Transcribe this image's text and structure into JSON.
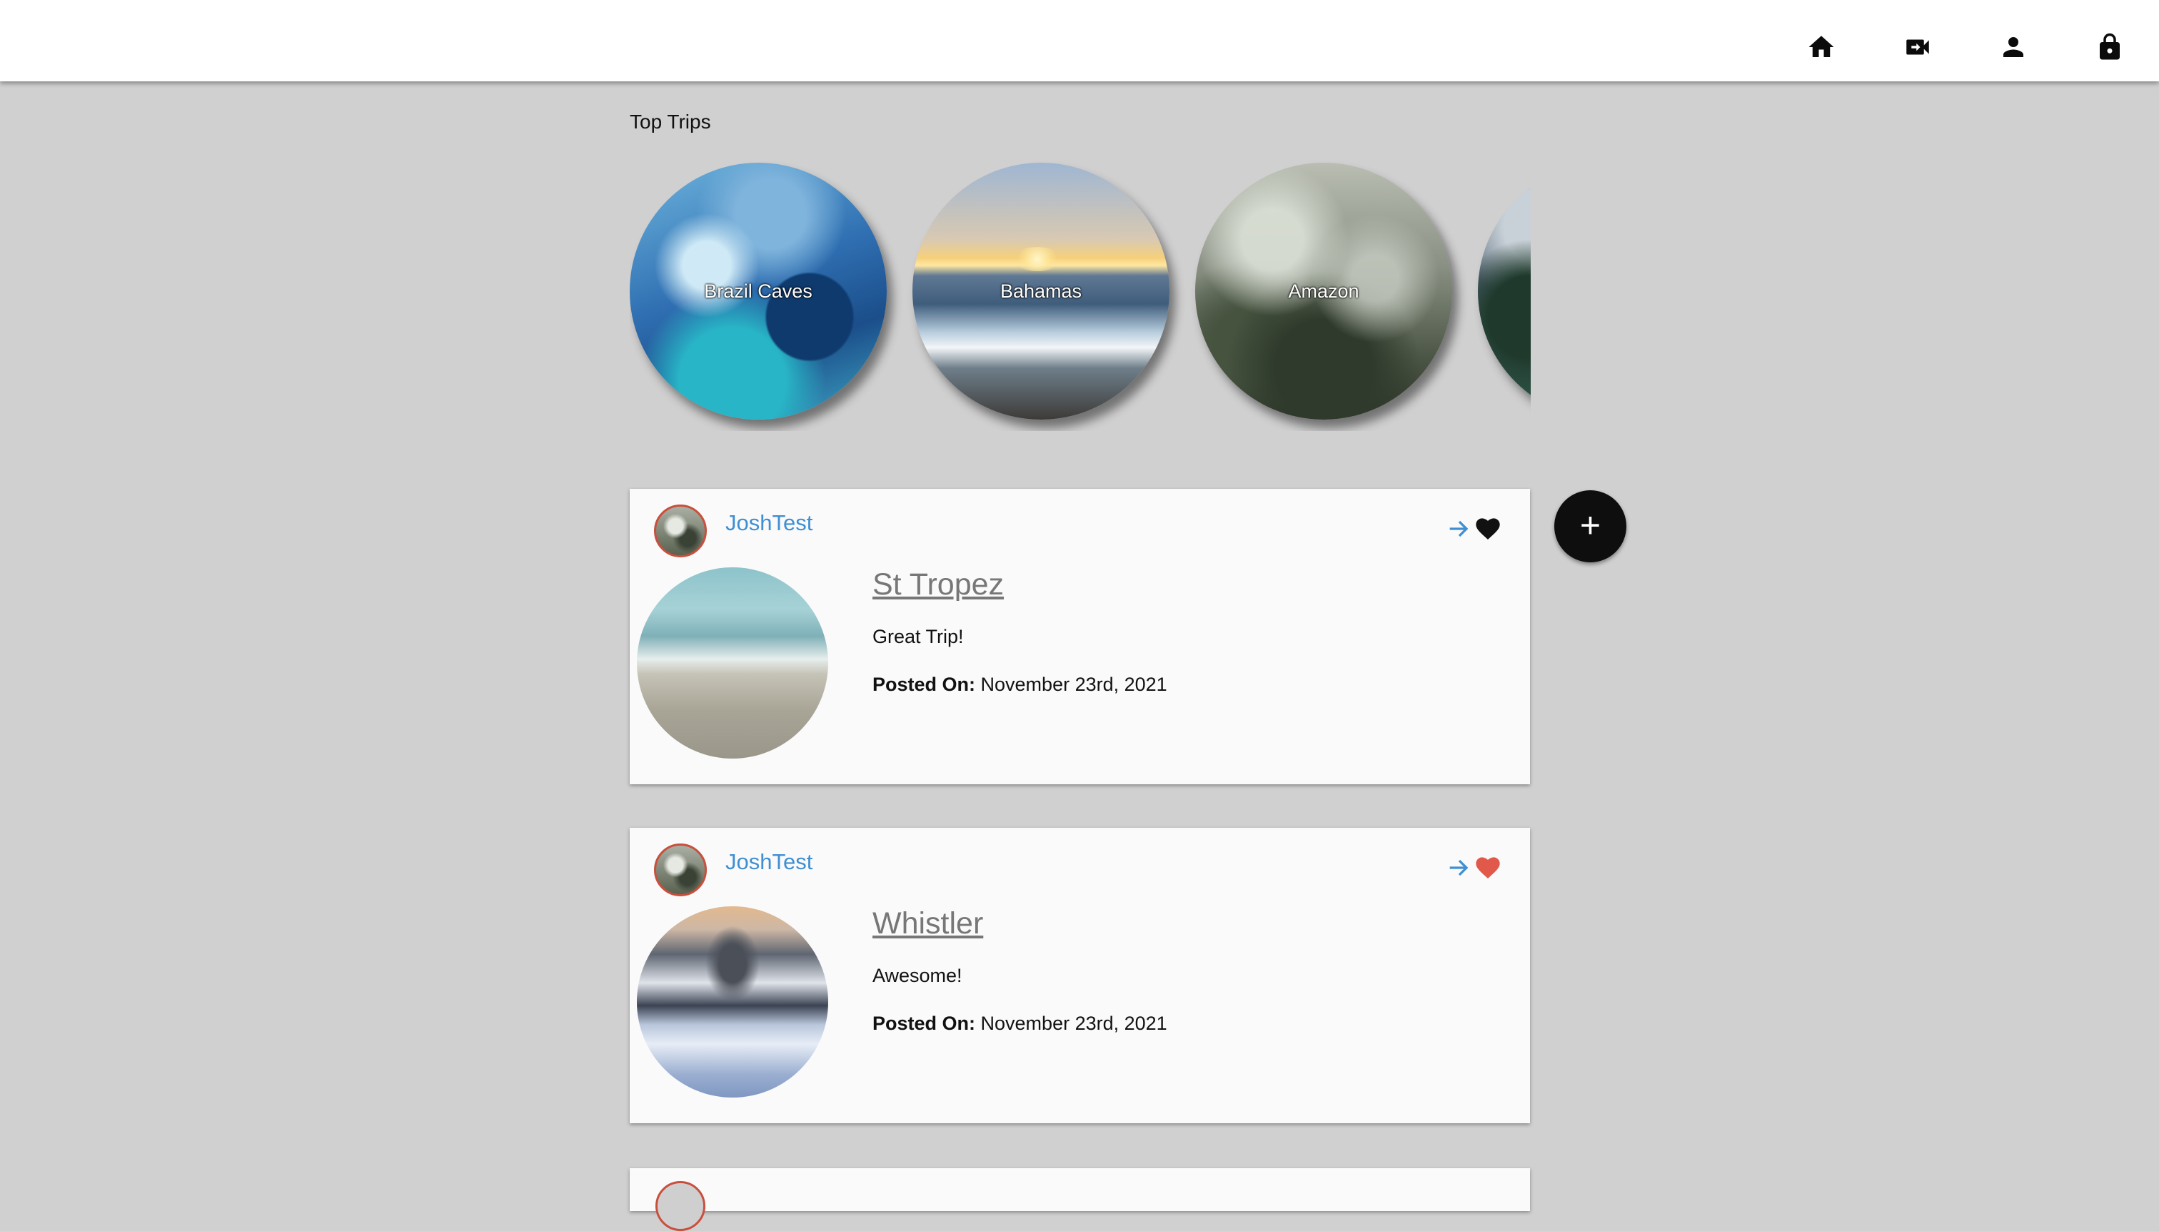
{
  "nav": {
    "items": [
      {
        "name": "home",
        "icon": "home-icon"
      },
      {
        "name": "videos",
        "icon": "video-camera-icon"
      },
      {
        "name": "profile",
        "icon": "person-icon"
      },
      {
        "name": "logout",
        "icon": "lock-icon"
      }
    ]
  },
  "top_trips": {
    "title": "Top Trips",
    "items": [
      {
        "label": "Brazil Caves"
      },
      {
        "label": "Bahamas"
      },
      {
        "label": "Amazon"
      },
      {
        "label": ""
      }
    ]
  },
  "posts": [
    {
      "username": "JoshTest",
      "title": "St Tropez",
      "description": "Great Trip!",
      "posted_label": "Posted On:",
      "posted_date": "November 23rd, 2021",
      "liked": false,
      "heart_color": "#111111"
    },
    {
      "username": "JoshTest",
      "title": "Whistler",
      "description": "Awesome!",
      "posted_label": "Posted On:",
      "posted_date": "November 23rd, 2021",
      "liked": true,
      "heart_color": "#e0594a"
    }
  ],
  "fab": {
    "label": "+"
  },
  "colors": {
    "background": "#d1d0d0",
    "accent": "#3f8fd2",
    "liked_heart": "#e0594a",
    "fab": "#0e0e0e"
  }
}
